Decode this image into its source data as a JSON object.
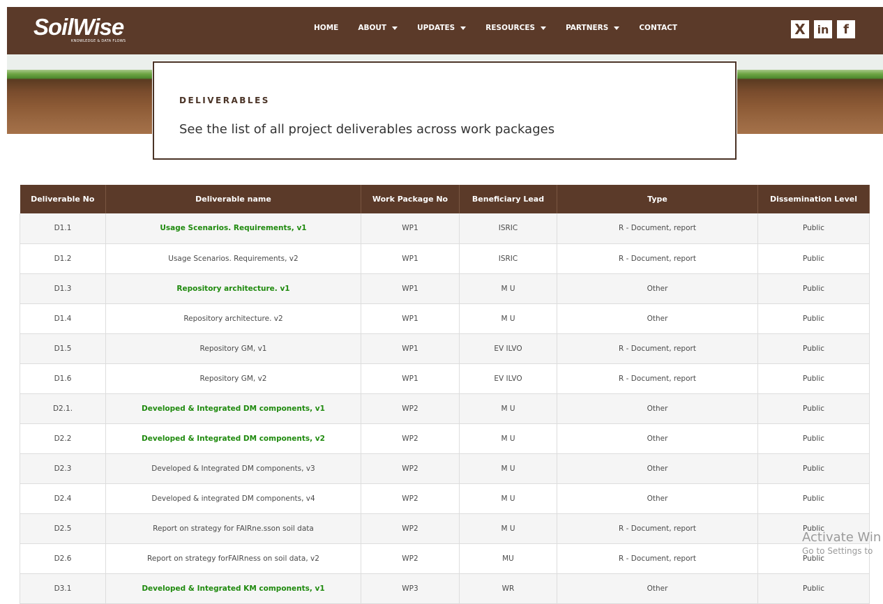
{
  "brand": {
    "name": "SoilWise",
    "tagline": "KNOWLEDGE & DATA FLOWS"
  },
  "nav": {
    "items": [
      {
        "label": "HOME",
        "dropdown": false
      },
      {
        "label": "ABOUT",
        "dropdown": true
      },
      {
        "label": "UPDATES",
        "dropdown": true
      },
      {
        "label": "RESOURCES",
        "dropdown": true
      },
      {
        "label": "PARTNERS",
        "dropdown": true
      },
      {
        "label": "CONTACT",
        "dropdown": false
      }
    ]
  },
  "social": {
    "x": "X",
    "linkedin": "in",
    "facebook": "f"
  },
  "hero": {
    "kicker": "DELIVERABLES",
    "heading": "See the list of all project deliverables across work packages"
  },
  "table": {
    "headers": [
      "Deliverable No",
      "Deliverable name",
      "Work Package No",
      "Beneficiary Lead",
      "Type",
      "Dissemination Level"
    ],
    "rows": [
      {
        "no": "D1.1",
        "name": "Usage Scenarios. Requirements, v1",
        "link": true,
        "wp": "WP1",
        "lead": "ISRIC",
        "type": "R - Document, report",
        "level": "Public"
      },
      {
        "no": "D1.2",
        "name": "Usage Scenarios. Requirements, v2",
        "link": false,
        "wp": "WP1",
        "lead": "ISRIC",
        "type": "R - Document, report",
        "level": "Public"
      },
      {
        "no": "D1.3",
        "name": "Repository architecture. v1",
        "link": true,
        "wp": "WP1",
        "lead": "M U",
        "type": "Other",
        "level": "Public"
      },
      {
        "no": "D1.4",
        "name": "Repository architecture. v2",
        "link": false,
        "wp": "WP1",
        "lead": "M U",
        "type": "Other",
        "level": "Public"
      },
      {
        "no": "D1.5",
        "name": "Repository GM, v1",
        "link": false,
        "wp": "WP1",
        "lead": "EV ILVO",
        "type": "R - Document, report",
        "level": "Public"
      },
      {
        "no": "D1.6",
        "name": "Repository GM, v2",
        "link": false,
        "wp": "WP1",
        "lead": "EV ILVO",
        "type": "R - Document, report",
        "level": "Public"
      },
      {
        "no": "D2.1.",
        "name": "Developed & Integrated DM components, v1",
        "link": true,
        "wp": "WP2",
        "lead": "M U",
        "type": "Other",
        "level": "Public"
      },
      {
        "no": "D2.2",
        "name": "Developed & Integrated DM components, v2",
        "link": true,
        "wp": "WP2",
        "lead": "M U",
        "type": "Other",
        "level": "Public"
      },
      {
        "no": "D2.3",
        "name": "Developed & Integrated DM components, v3",
        "link": false,
        "wp": "WP2",
        "lead": "M U",
        "type": "Other",
        "level": "Public"
      },
      {
        "no": "D2.4",
        "name": "Developed & integrated DM components, v4",
        "link": false,
        "wp": "WP2",
        "lead": "M U",
        "type": "Other",
        "level": "Public"
      },
      {
        "no": "D2.5",
        "name": "Report on strategy for FAIRne.sson soil data",
        "link": false,
        "wp": "WP2",
        "lead": "M U",
        "type": "R - Document, report",
        "level": "Public"
      },
      {
        "no": "D2.6",
        "name": "Report on strategy forFAIRness on soil data, v2",
        "link": false,
        "wp": "WP2",
        "lead": "MU",
        "type": "R - Document, report",
        "level": "Public"
      },
      {
        "no": "D3.1",
        "name": "Developed & Integrated KM components, v1",
        "link": true,
        "wp": "WP3",
        "lead": "WR",
        "type": "Other",
        "level": "Public"
      }
    ]
  },
  "watermark": {
    "line1": "Activate Win",
    "line2": "Go to Settings to"
  },
  "colors": {
    "brand_brown": "#5b3a29",
    "link_green": "#1f8a0e"
  }
}
